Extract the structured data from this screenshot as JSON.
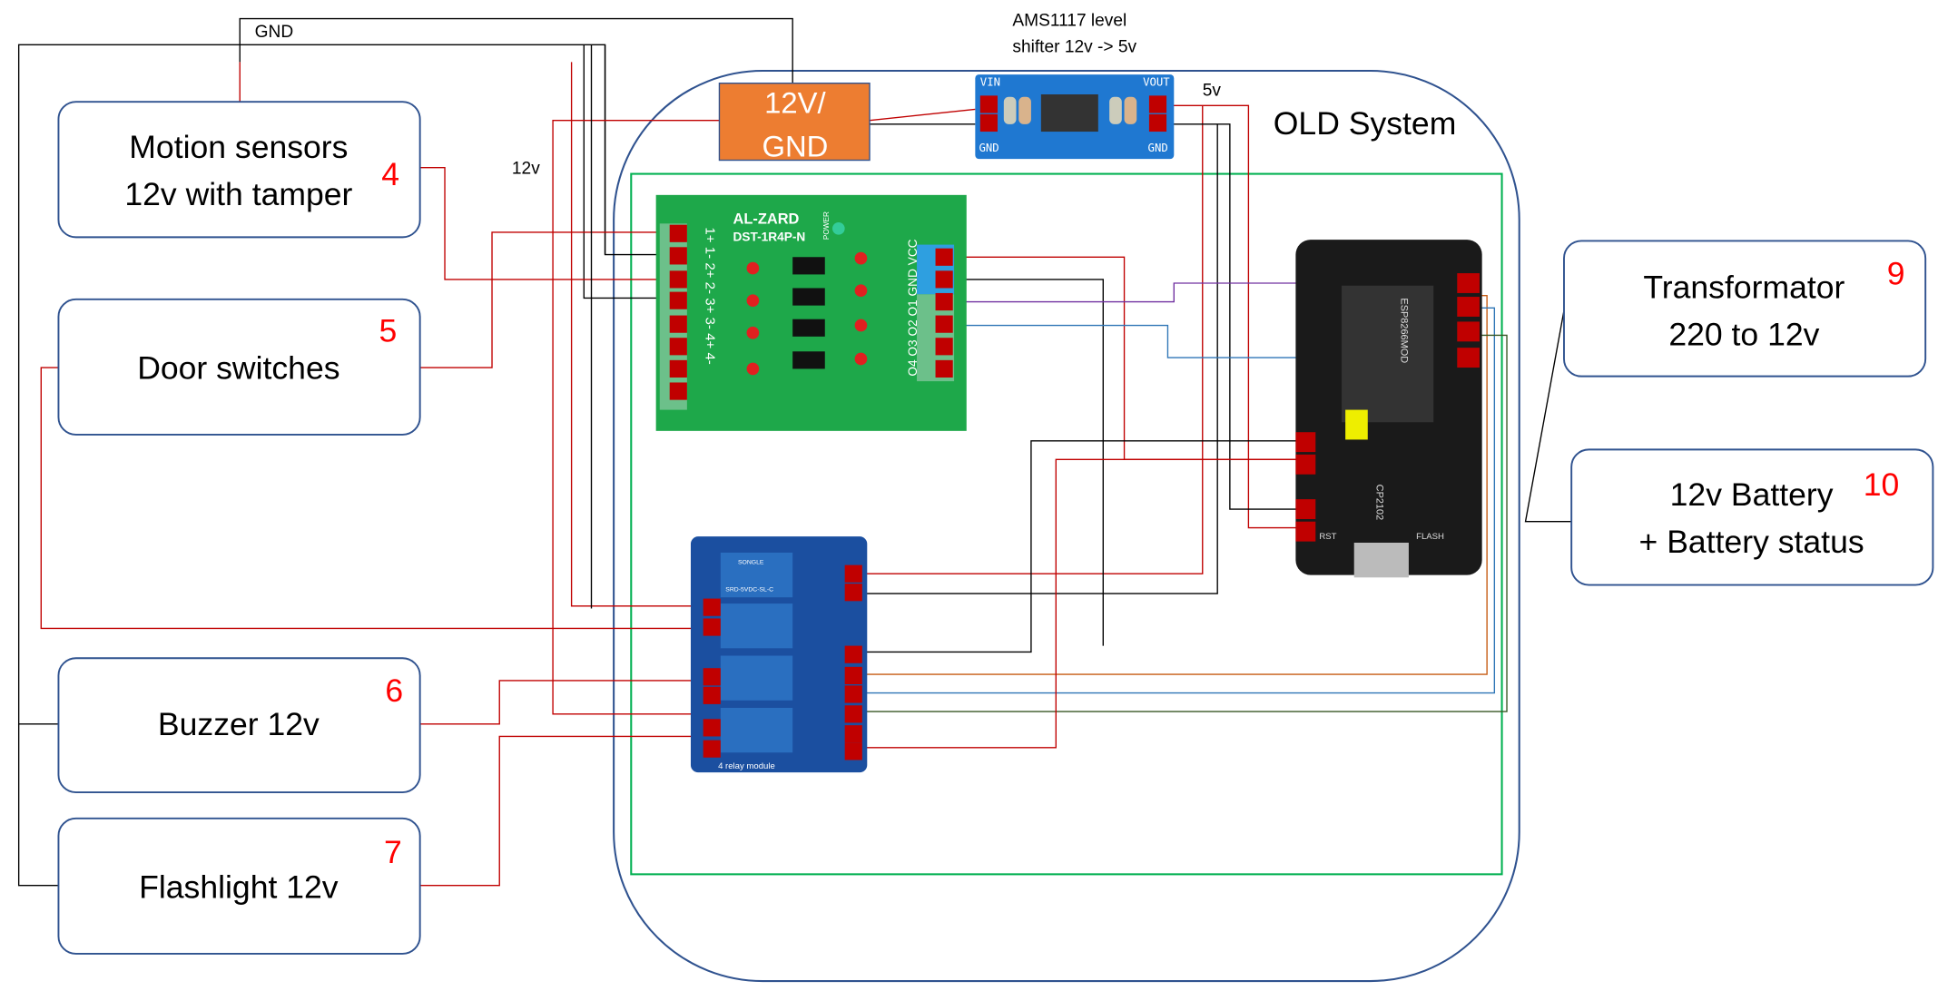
{
  "labels": {
    "gnd": "GND",
    "twelve_v": "12v",
    "five_v": "5v",
    "ams_line1": "AMS1117  level",
    "ams_line2": "shifter 12v -> 5v",
    "old_system": "OLD System",
    "psu_line1": "12V/",
    "psu_line2": "GND"
  },
  "devices": [
    {
      "line1": "Motion sensors",
      "line2": "12v with tamper",
      "number": "4"
    },
    {
      "line1": "Door switches",
      "line2": "",
      "number": "5"
    },
    {
      "line1": "Buzzer 12v",
      "line2": "",
      "number": "6"
    },
    {
      "line1": "Flashlight 12v",
      "line2": "",
      "number": "7"
    },
    {
      "line1": "Transformator",
      "line2": "220 to 12v",
      "number": "9"
    },
    {
      "line1": "12v Battery",
      "line2": "+ Battery status",
      "number": "10"
    }
  ],
  "boards": {
    "opto": {
      "brand": "AL-ZARD",
      "model": "DST-1R4P-N",
      "inputs": "1+ 1- 2+ 2- 3+ 3- 4+ 4-",
      "outputs": "O4 O3 O2 O1 GND VCC",
      "power": "POWER"
    },
    "ams": {
      "vin": "VIN",
      "vout": "VOUT",
      "gnd": "GND"
    },
    "esp": {
      "chip": "ESP8266MOD",
      "usb": "CP2102",
      "rst": "RST",
      "flash": "FLASH"
    },
    "relay": {
      "relay_text": "SRD-5VDC-SL-C",
      "brand": "SONGLE",
      "footer": "4 relay module"
    }
  },
  "colors": {
    "container": "#2f528f",
    "green_frame": "#00b050",
    "psu": "#ed7d31",
    "wire_red": "#c00000",
    "number_red": "#ff0000"
  }
}
